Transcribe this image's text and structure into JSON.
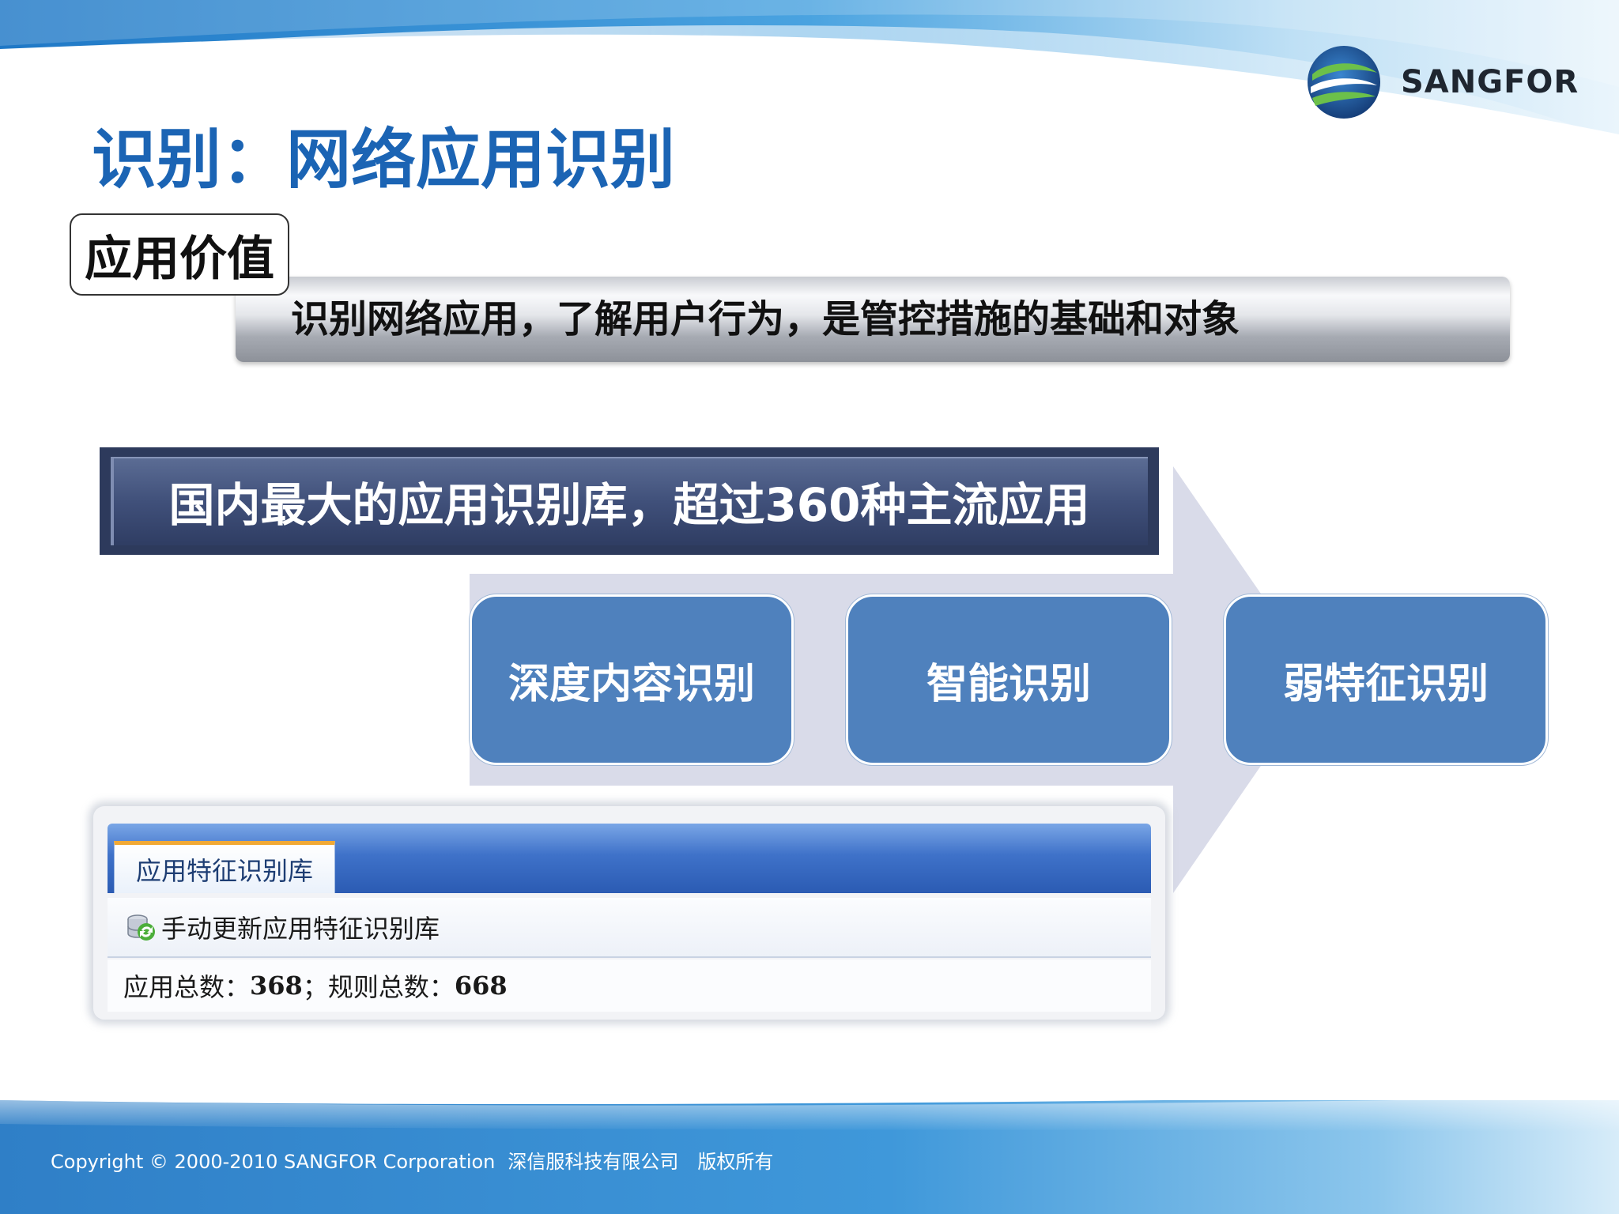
{
  "brand": {
    "name": "SANGFOR",
    "colors": {
      "title": "#1b64b4",
      "banner": "#2d3a5c",
      "method_box": "#4f81bd",
      "footer_band": "#2f7fc7"
    }
  },
  "title": {
    "text": "识别：网络应用识别"
  },
  "value": {
    "label": "应用价值",
    "statement": "识别网络应用，了解用户行为，是管控措施的基础和对象"
  },
  "library": {
    "banner": "国内最大的应用识别库，超过360种主流应用"
  },
  "methods": [
    {
      "label": "深度内容识别"
    },
    {
      "label": "智能识别"
    },
    {
      "label": "弱特征识别"
    }
  ],
  "ui_panel": {
    "tab_label": "应用特征识别库",
    "update_icon": "database-refresh-icon",
    "update_label": "手动更新应用特征识别库",
    "stats": {
      "apps_label": "应用总数：",
      "apps_value": "368",
      "separator": "；",
      "rules_label": "规则总数：",
      "rules_value": "668"
    }
  },
  "footer": {
    "copyright": "Copyright © 2000-2010 SANGFOR Corporation",
    "company": "深信服科技有限公司",
    "rights": "版权所有"
  }
}
